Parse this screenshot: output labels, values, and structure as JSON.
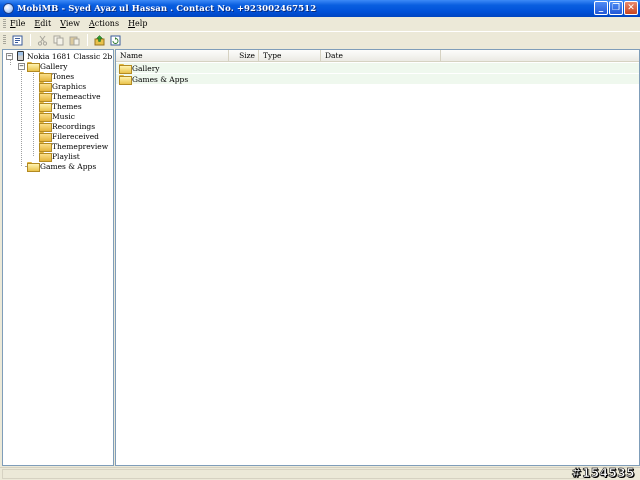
{
  "window": {
    "title": "MobiMB - Syed Ayaz ul Hassan . Contact No. +923002467512",
    "buttons": {
      "minimize": "_",
      "maximize": "❐",
      "close": "✕"
    }
  },
  "menu": [
    {
      "label": "File",
      "accel": "F",
      "rest": "ile"
    },
    {
      "label": "Edit",
      "accel": "E",
      "rest": "dit"
    },
    {
      "label": "View",
      "accel": "V",
      "rest": "iew"
    },
    {
      "label": "Actions",
      "accel": "A",
      "rest": "ctions"
    },
    {
      "label": "Help",
      "accel": "H",
      "rest": "elp"
    }
  ],
  "toolbar": {
    "icons": [
      "properties-icon",
      "cut-icon",
      "copy-icon",
      "paste-icon",
      "upload-icon",
      "refresh-icon"
    ]
  },
  "tree": {
    "root": "Nokia 1681 Classic 2b",
    "gallery": "Gallery",
    "gallery_children": [
      "Tones",
      "Graphics",
      "Themeactive",
      "Themes",
      "Music",
      "Recordings",
      "Filereceived",
      "Themepreview",
      "Playlist"
    ],
    "games": "Games & Apps",
    "collapse_symbol": "−"
  },
  "list": {
    "columns": {
      "name": "Name",
      "size": "Size",
      "type": "Type",
      "date": "Date"
    },
    "rows": [
      {
        "name": "Gallery"
      },
      {
        "name": "Games & Apps"
      }
    ]
  },
  "status": {
    "watermark": "#154535"
  },
  "colors": {
    "titlebar": "#0050d8",
    "row_highlight": "#eff8ee",
    "folder": "#e4b43c"
  }
}
